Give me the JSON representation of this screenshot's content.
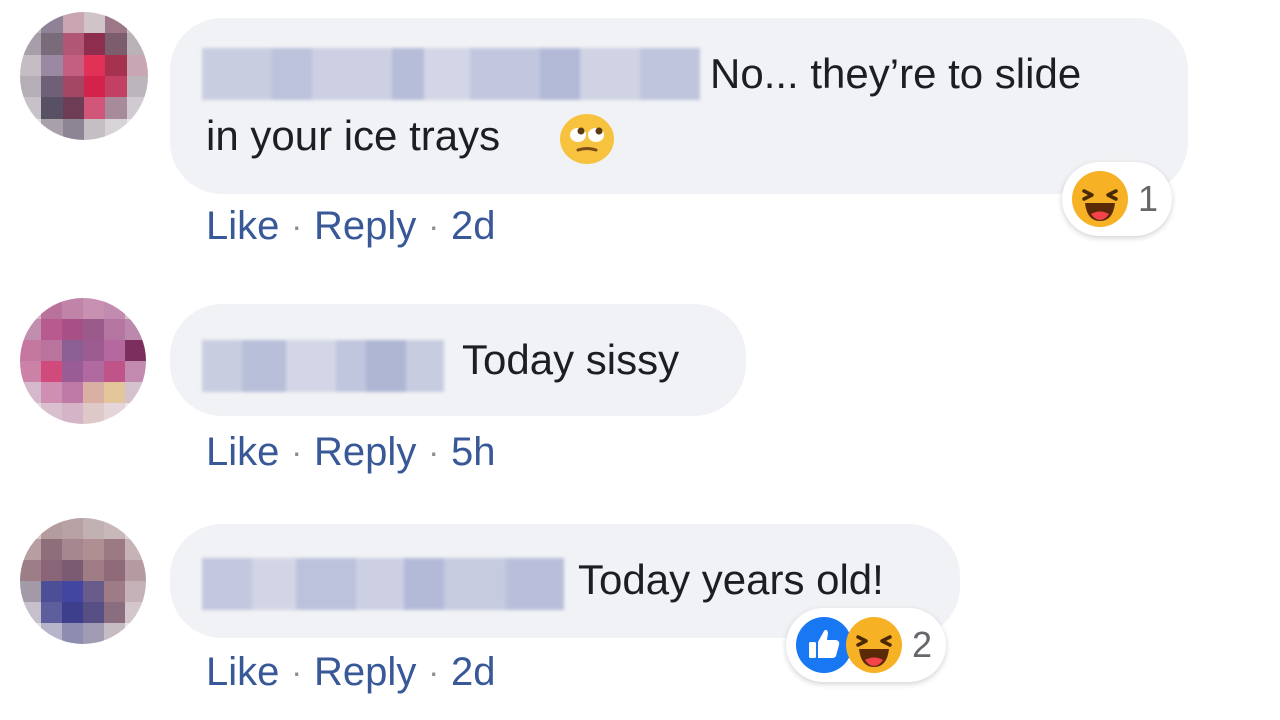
{
  "comments": [
    {
      "text_line1": "No... they’re to slide",
      "text_line2": "in your ice trays",
      "inline_emoji": "face-with-rolling-eyes-icon",
      "actions": {
        "like": "Like",
        "reply": "Reply",
        "time": "2d"
      },
      "reactions": {
        "icons": [
          "haha-reaction-icon"
        ],
        "count": "1"
      }
    },
    {
      "text": "Today sissy",
      "actions": {
        "like": "Like",
        "reply": "Reply",
        "time": "5h"
      }
    },
    {
      "text": "Today years old!",
      "actions": {
        "like": "Like",
        "reply": "Reply",
        "time": "2d"
      },
      "reactions": {
        "icons": [
          "like-reaction-icon",
          "haha-reaction-icon"
        ],
        "count": "2"
      }
    }
  ],
  "separator": "·",
  "colors": {
    "bubble": "#f0f2f5",
    "link": "#385898",
    "text": "#1c1e21",
    "like_blue": "#1877f2",
    "haha_yellow": "#f7b125"
  }
}
